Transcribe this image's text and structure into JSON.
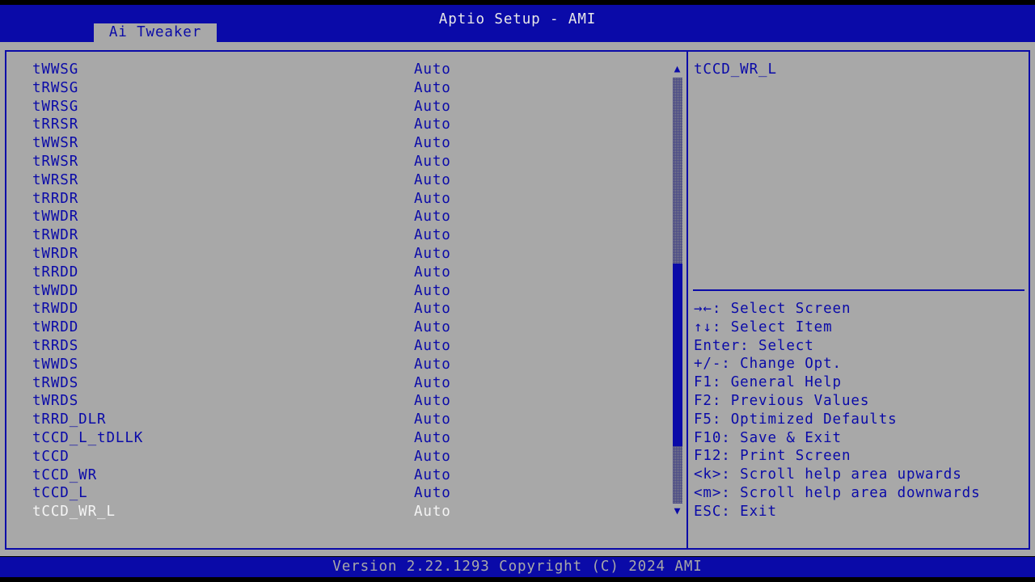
{
  "header": {
    "title": "Aptio Setup - AMI",
    "active_tab": "Ai Tweaker"
  },
  "settings": [
    {
      "label": "tWWSG",
      "value": "Auto"
    },
    {
      "label": "tRWSG",
      "value": "Auto"
    },
    {
      "label": "tWRSG",
      "value": "Auto"
    },
    {
      "label": "tRRSR",
      "value": "Auto"
    },
    {
      "label": "tWWSR",
      "value": "Auto"
    },
    {
      "label": "tRWSR",
      "value": "Auto"
    },
    {
      "label": "tWRSR",
      "value": "Auto"
    },
    {
      "label": "tRRDR",
      "value": "Auto"
    },
    {
      "label": "tWWDR",
      "value": "Auto"
    },
    {
      "label": "tRWDR",
      "value": "Auto"
    },
    {
      "label": "tWRDR",
      "value": "Auto"
    },
    {
      "label": "tRRDD",
      "value": "Auto"
    },
    {
      "label": "tWWDD",
      "value": "Auto"
    },
    {
      "label": "tRWDD",
      "value": "Auto"
    },
    {
      "label": "tWRDD",
      "value": "Auto"
    },
    {
      "label": "tRRDS",
      "value": "Auto"
    },
    {
      "label": "tWWDS",
      "value": "Auto"
    },
    {
      "label": "tRWDS",
      "value": "Auto"
    },
    {
      "label": "tWRDS",
      "value": "Auto"
    },
    {
      "label": "tRRD_DLR",
      "value": "Auto"
    },
    {
      "label": "tCCD_L_tDLLK",
      "value": "Auto"
    },
    {
      "label": "tCCD",
      "value": "Auto"
    },
    {
      "label": "tCCD_WR",
      "value": "Auto"
    },
    {
      "label": "tCCD_L",
      "value": "Auto"
    },
    {
      "label": "tCCD_WR_L",
      "value": "Auto",
      "selected": true
    }
  ],
  "scrollbar": {
    "up_glyph": "▲",
    "down_glyph": "▼",
    "position_fraction": 0.55
  },
  "help": {
    "title": "tCCD_WR_L",
    "keys": [
      "→←: Select Screen",
      "↑↓: Select Item",
      "Enter: Select",
      "+/-: Change Opt.",
      "F1: General Help",
      "F2: Previous Values",
      "F5: Optimized Defaults",
      "F10: Save & Exit",
      "F12: Print Screen",
      "<k>: Scroll help area upwards",
      "<m>: Scroll help area downwards",
      "ESC: Exit"
    ]
  },
  "footer": {
    "version": "Version 2.22.1293 Copyright (C) 2024 AMI"
  },
  "colors": {
    "background": "#a8a8a8",
    "bar": "#0a0aa8",
    "text": "#0a0aa8",
    "selected_text": "#f4f4f4"
  }
}
